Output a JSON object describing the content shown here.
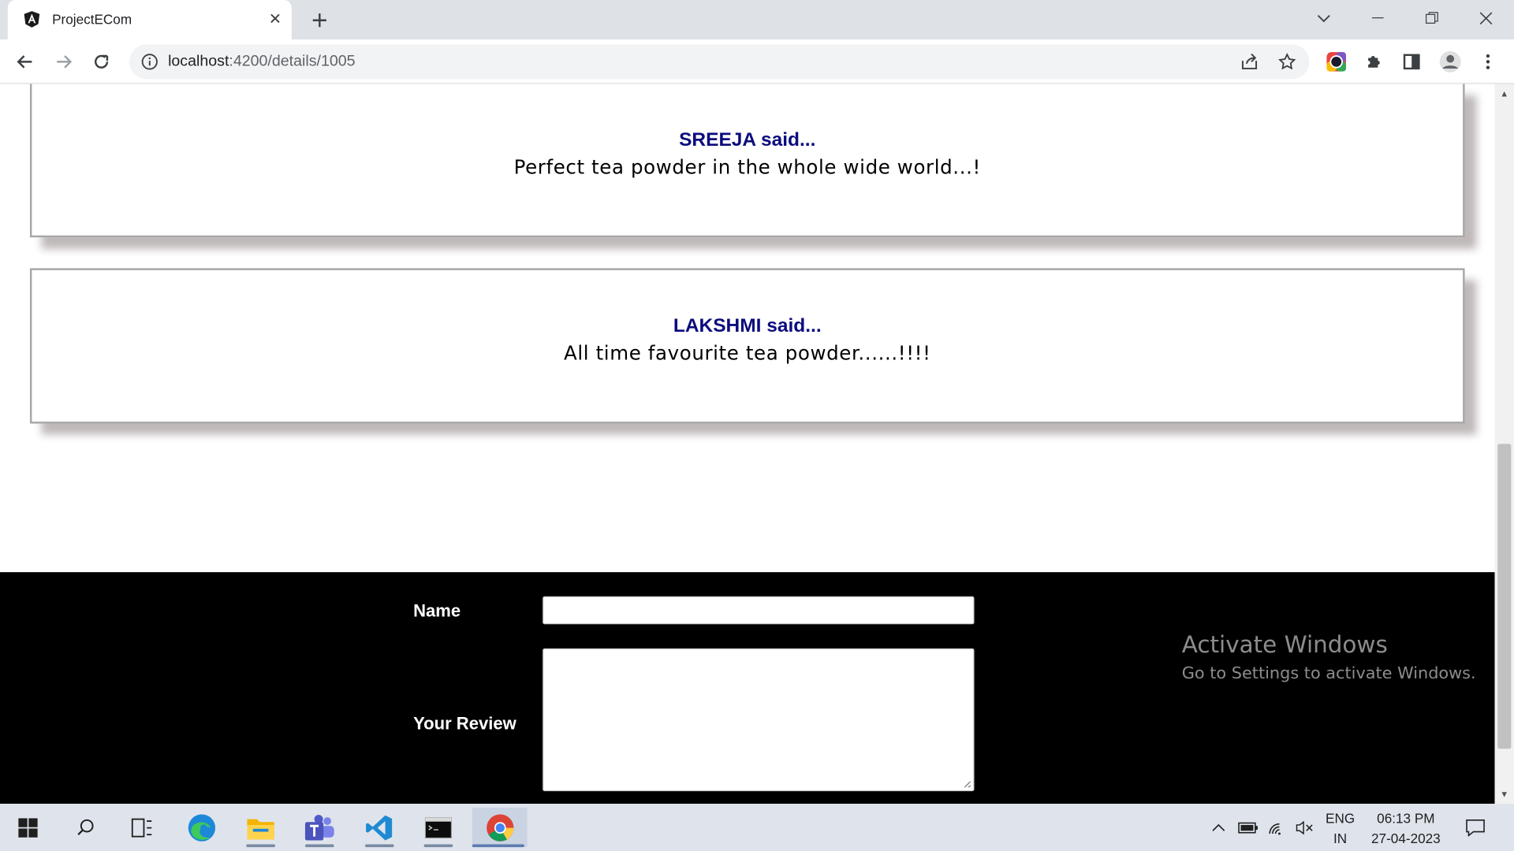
{
  "browser": {
    "tab_title": "ProjectECom",
    "url_host": "localhost",
    "url_rest": ":4200/details/1005"
  },
  "reviews": [
    {
      "author": "SREEJA said...",
      "text": "Perfect tea powder in the whole wide world...!"
    },
    {
      "author": "LAKSHMI said...",
      "text": "All time favourite tea powder......!!!!"
    }
  ],
  "form": {
    "name_label": "Name",
    "name_value": "",
    "review_label": "Your Review",
    "review_value": ""
  },
  "watermark": {
    "title": "Activate Windows",
    "subtitle": "Go to Settings to activate Windows."
  },
  "taskbar": {
    "lang_top": "ENG",
    "lang_bottom": "IN",
    "time": "06:13 PM",
    "date": "27-04-2023"
  }
}
